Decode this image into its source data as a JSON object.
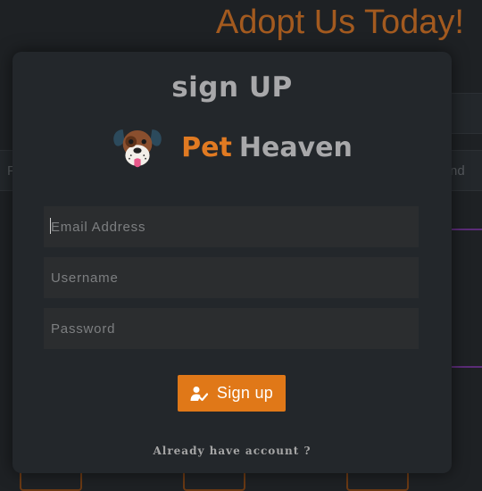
{
  "background": {
    "page_title": "Adopt Us Today!",
    "side_text_left": "F",
    "side_text_right": "nd"
  },
  "modal": {
    "title": "sign UP",
    "brand": {
      "name_part1": "Pet",
      "name_part2": "Heaven",
      "logo_icon": "dog-face-icon"
    },
    "form": {
      "email_placeholder": "Email Address",
      "username_placeholder": "Username",
      "password_placeholder": "Password",
      "submit_label": "Sign up",
      "submit_icon": "user-check-icon"
    },
    "login_prompt": "Already have account ?"
  },
  "colors": {
    "background": "#1e2124",
    "modal": "#23272b",
    "input": "#2b2d2f",
    "accent": "#e07818",
    "heading_text": "#a8a8aa",
    "bg_title": "#a35a1f"
  }
}
